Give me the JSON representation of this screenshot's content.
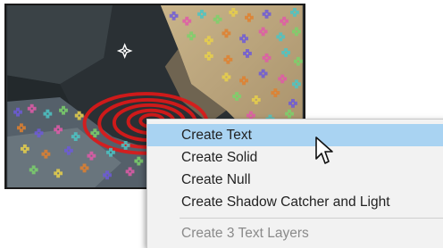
{
  "menu": {
    "items": [
      {
        "label": "Create Text",
        "highlighted": true,
        "disabled": false
      },
      {
        "label": "Create Solid",
        "highlighted": false,
        "disabled": false
      },
      {
        "label": "Create Null",
        "highlighted": false,
        "disabled": false
      },
      {
        "label": "Create Shadow Catcher and Light",
        "highlighted": false,
        "disabled": false
      },
      {
        "label": "Create 3 Text Layers",
        "highlighted": false,
        "disabled": true
      }
    ]
  },
  "colors": {
    "highlight": "#a9d3f2",
    "menu_background": "#f2f2f2",
    "track_points": [
      "#6d5bd8",
      "#e05aa8",
      "#4cc4c4",
      "#7bd16b",
      "#e8d04a",
      "#e0802e"
    ]
  },
  "icons": {
    "cursor": "arrow-cursor-icon",
    "target": "crosshair-target-icon"
  }
}
